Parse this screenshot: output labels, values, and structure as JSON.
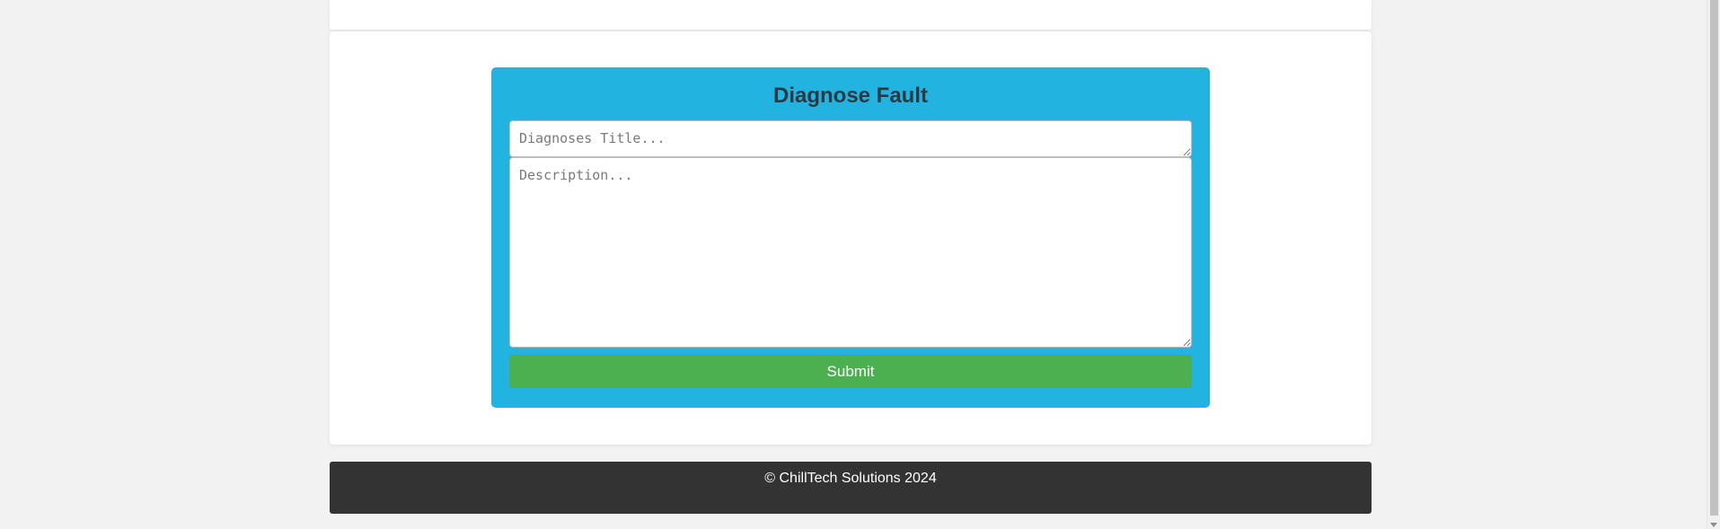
{
  "form": {
    "title": "Diagnose Fault",
    "title_placeholder": "Diagnoses Title...",
    "description_placeholder": "Description...",
    "submit_label": "Submit"
  },
  "footer": {
    "text": "© ChillTech Solutions 2024"
  },
  "colors": {
    "panel": "#22b3e0",
    "submit": "#4caf50",
    "footer": "#333333",
    "background": "#f2f2f2"
  }
}
